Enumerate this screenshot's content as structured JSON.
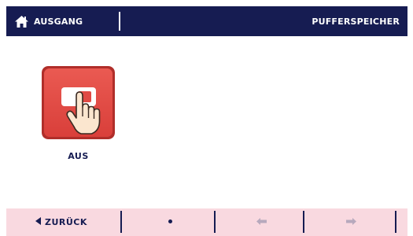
{
  "header": {
    "home_label": "AUSGANG",
    "title": "PUFFERSPEICHER",
    "background": "#161c52"
  },
  "tile": {
    "label": "AUS",
    "icon": "hand-press-switch-icon",
    "color": "#e04a45"
  },
  "footer": {
    "back_label": "ZURÜCK",
    "back_icon": "triangle-left-icon",
    "page_indicator_icon": "dot-icon",
    "prev_icon": "arrow-left-icon",
    "next_icon": "arrow-right-icon",
    "background": "#f9d9e0"
  }
}
